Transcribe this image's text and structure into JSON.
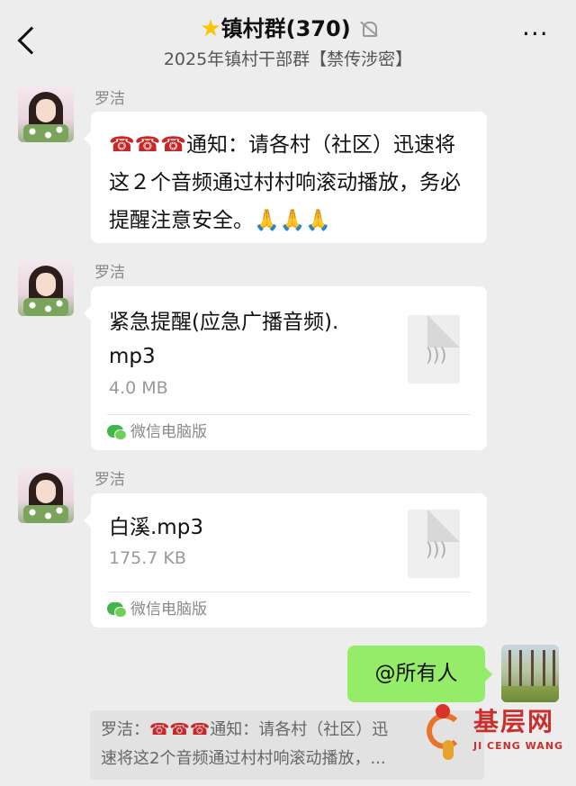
{
  "header": {
    "star_icon": "★",
    "title": "镇村群(370)",
    "subtitle": "2025年镇村干部群【禁传涉密】",
    "more_icon": "···"
  },
  "messages": [
    {
      "sender": "罗洁",
      "phone_emoji": "☎☎☎",
      "text": "通知：请各村（社区）迅速将这２个音频通过村村响滚动播放，务必提醒注意安全。",
      "pray_emoji": "🙏🙏🙏"
    },
    {
      "sender": "罗洁",
      "file_name_line1": "紧急提醒(应急广播音频).",
      "file_name_line2": "mp3",
      "file_size": "4.0 MB",
      "source": "微信电脑版"
    },
    {
      "sender": "罗洁",
      "file_name_line1": "白溪.mp3",
      "file_size": "175.7 KB",
      "source": "微信电脑版"
    }
  ],
  "my_message": {
    "text": "@所有人"
  },
  "quote": {
    "prefix": "罗洁：",
    "phone_emoji": "☎☎☎",
    "text_line1": "通知：请各村（社区）迅",
    "text_line2": "速将这2个音频通过村村响滚动播放，..."
  },
  "watermark": {
    "title": "基层网",
    "subtitle": "JI CENG WANG"
  },
  "colors": {
    "background": "#ededed",
    "my_bubble": "#95ec69",
    "wechat_green": "#43b649",
    "watermark_red": "#c9302c"
  }
}
